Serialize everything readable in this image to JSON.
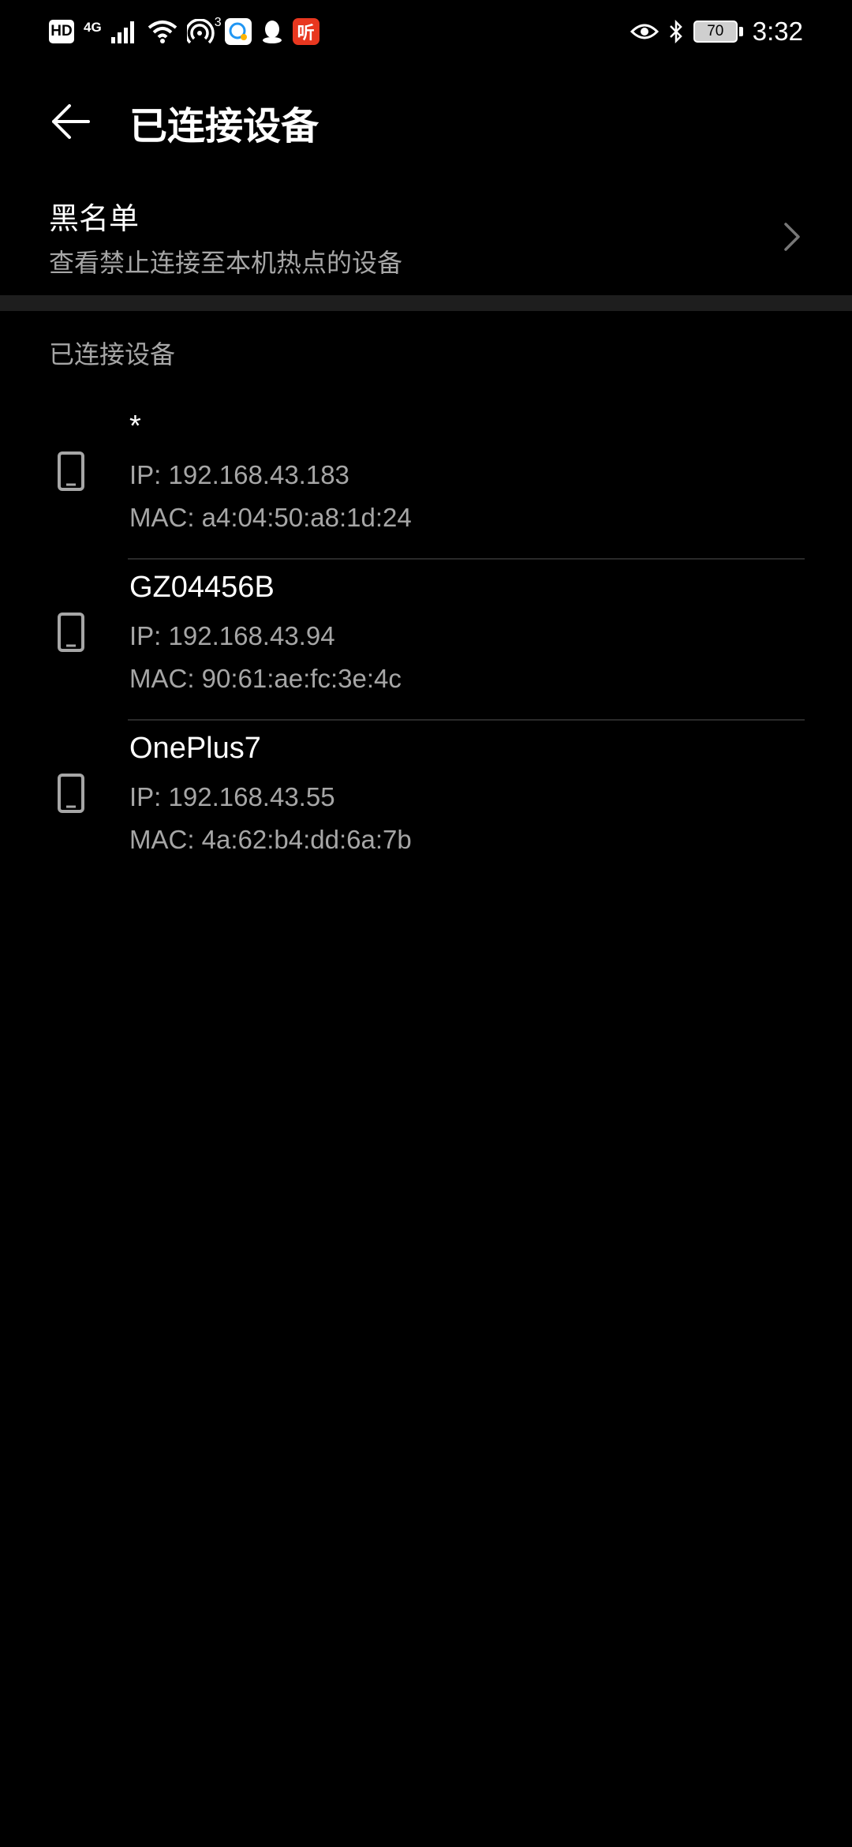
{
  "status_bar": {
    "hd_label": "HD",
    "network_label": "4G",
    "hotspot_count": "3",
    "tingyun_label": "听",
    "battery": "70",
    "time": "3:32"
  },
  "header": {
    "title": "已连接设备"
  },
  "blacklist": {
    "title": "黑名单",
    "subtitle": "查看禁止连接至本机热点的设备"
  },
  "section": {
    "title": "已连接设备"
  },
  "devices": [
    {
      "name": "*",
      "ip": "IP: 192.168.43.183",
      "mac": "MAC: a4:04:50:a8:1d:24"
    },
    {
      "name": "GZ04456B",
      "ip": "IP: 192.168.43.94",
      "mac": "MAC: 90:61:ae:fc:3e:4c"
    },
    {
      "name": "OnePlus7",
      "ip": "IP: 192.168.43.55",
      "mac": "MAC: 4a:62:b4:dd:6a:7b"
    }
  ]
}
